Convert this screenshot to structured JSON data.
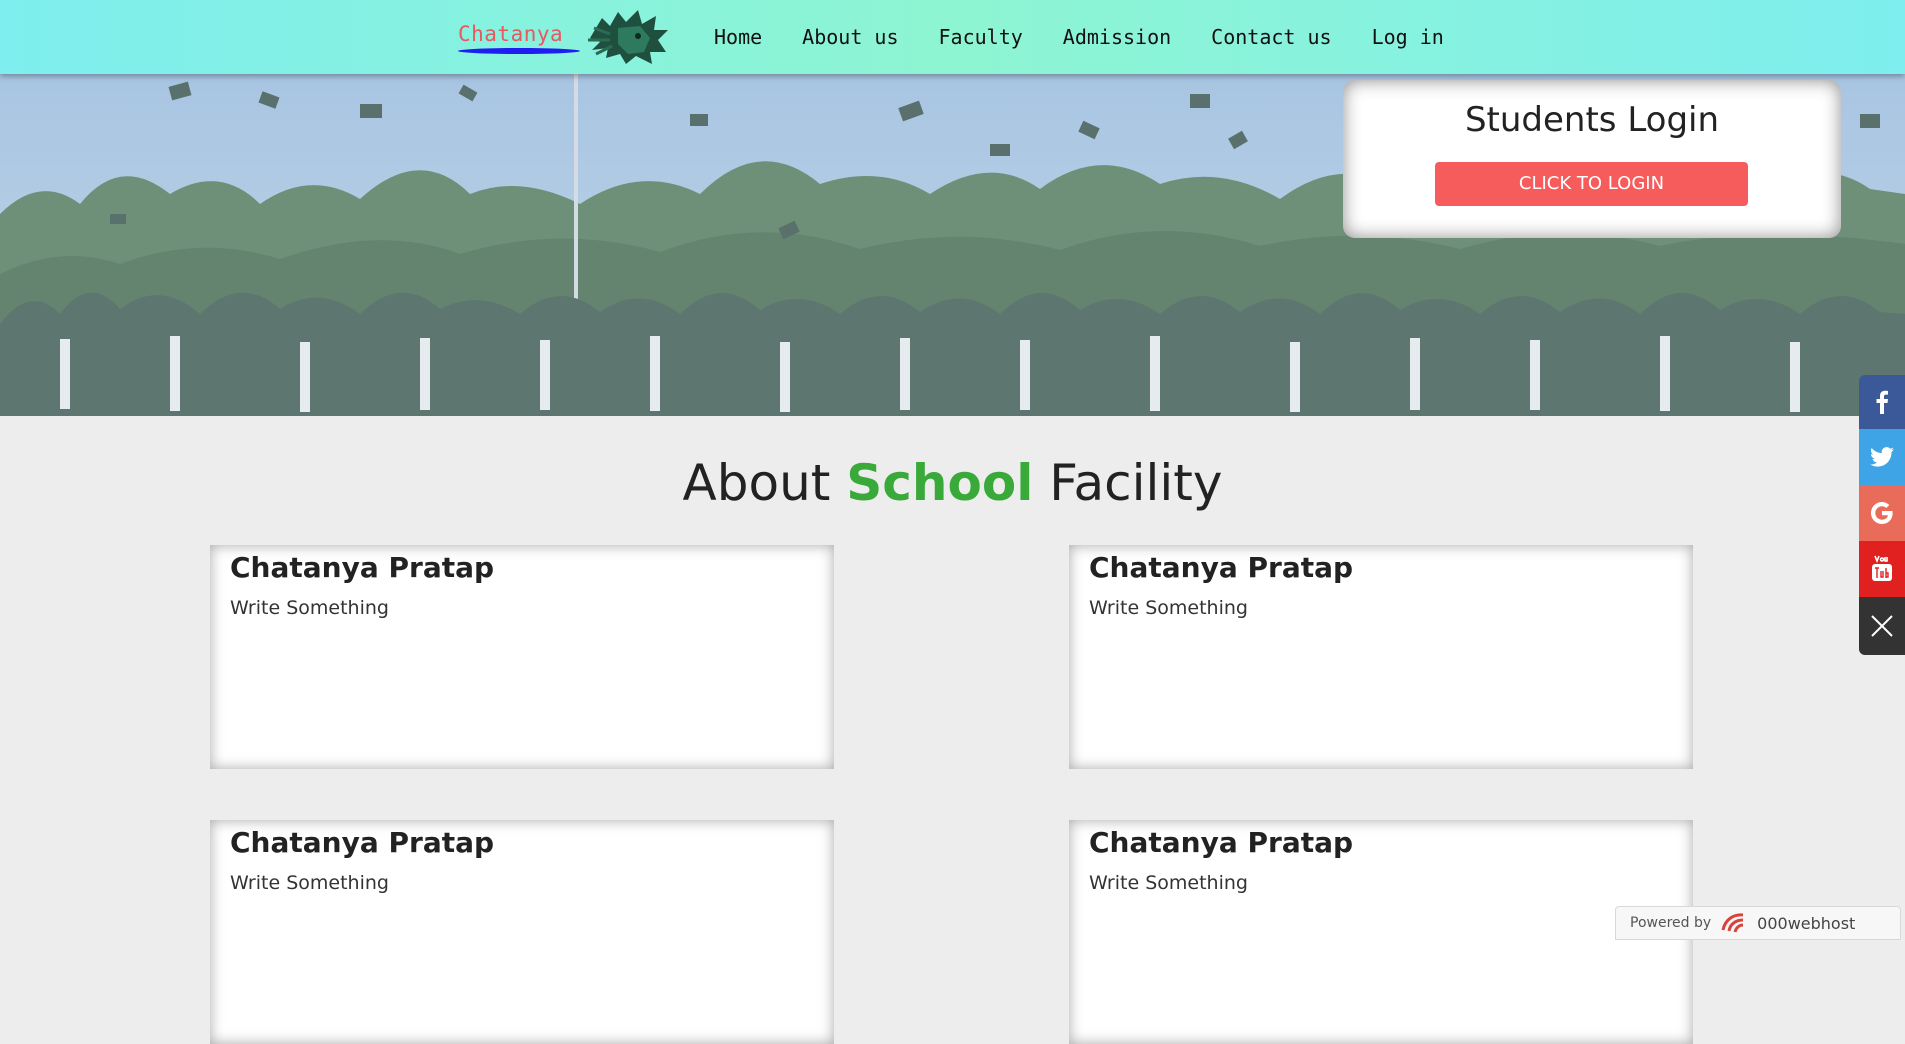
{
  "navbar": {
    "brand": "Chatanya",
    "logo_icon": "lion-head-icon",
    "links": [
      "Home",
      "About us",
      "Faculty",
      "Admission",
      "Contact us",
      "Log in"
    ]
  },
  "login": {
    "title": "Students Login",
    "button": "CLICK TO LOGIN"
  },
  "section": {
    "title_before": "About",
    "title_accent": "School",
    "title_after": "Facility",
    "accent_color": "#39a93a"
  },
  "cards": [
    {
      "title": "Chatanya Pratap",
      "text": "Write Something"
    },
    {
      "title": "Chatanya Pratap",
      "text": "Write Something"
    },
    {
      "title": "Chatanya Pratap",
      "text": "Write Something"
    },
    {
      "title": "Chatanya Pratap",
      "text": "Write Something"
    }
  ],
  "social": [
    {
      "icon": "facebook-icon",
      "color": "#3b5998"
    },
    {
      "icon": "twitter-icon",
      "color": "#3ea4e6"
    },
    {
      "icon": "google-icon",
      "color": "#e96b5a"
    },
    {
      "icon": "youtube-icon",
      "color": "#e12020"
    },
    {
      "icon": "close-icon",
      "color": "#333333"
    }
  ],
  "powered": {
    "label": "Powered by",
    "host": "000webhost"
  }
}
